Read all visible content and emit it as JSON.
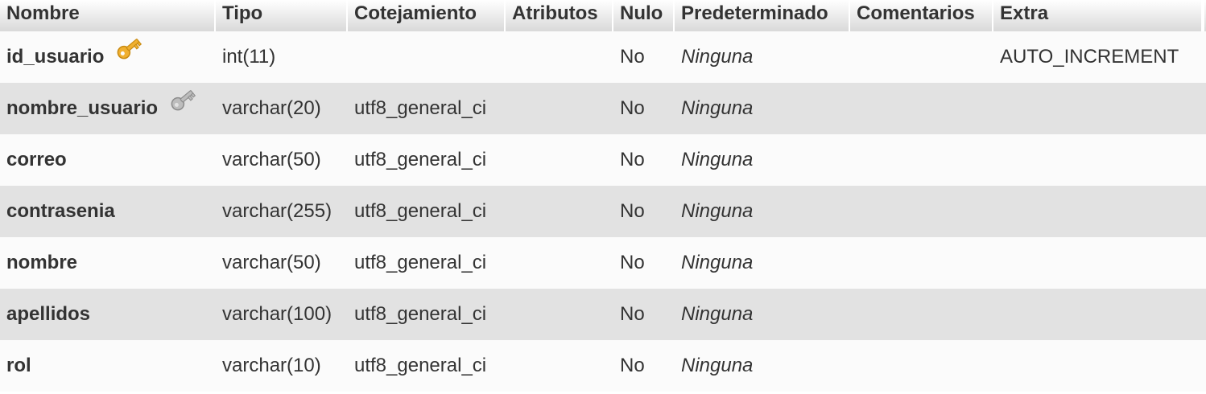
{
  "table": {
    "headers": {
      "nombre": "Nombre",
      "tipo": "Tipo",
      "cotejamiento": "Cotejamiento",
      "atributos": "Atributos",
      "nulo": "Nulo",
      "predeterminado": "Predeterminado",
      "comentarios": "Comentarios",
      "extra": "Extra"
    },
    "rows": [
      {
        "nombre": "id_usuario",
        "key_icon": "primary-key-icon",
        "tipo": "int(11)",
        "cotejamiento": "",
        "atributos": "",
        "nulo": "No",
        "predeterminado": "Ninguna",
        "comentarios": "",
        "extra": "AUTO_INCREMENT"
      },
      {
        "nombre": "nombre_usuario",
        "key_icon": "unique-key-icon",
        "tipo": "varchar(20)",
        "cotejamiento": "utf8_general_ci",
        "atributos": "",
        "nulo": "No",
        "predeterminado": "Ninguna",
        "comentarios": "",
        "extra": ""
      },
      {
        "nombre": "correo",
        "tipo": "varchar(50)",
        "cotejamiento": "utf8_general_ci",
        "atributos": "",
        "nulo": "No",
        "predeterminado": "Ninguna",
        "comentarios": "",
        "extra": ""
      },
      {
        "nombre": "contrasenia",
        "tipo": "varchar(255)",
        "cotejamiento": "utf8_general_ci",
        "atributos": "",
        "nulo": "No",
        "predeterminado": "Ninguna",
        "comentarios": "",
        "extra": ""
      },
      {
        "nombre": "nombre",
        "tipo": "varchar(50)",
        "cotejamiento": "utf8_general_ci",
        "atributos": "",
        "nulo": "No",
        "predeterminado": "Ninguna",
        "comentarios": "",
        "extra": ""
      },
      {
        "nombre": "apellidos",
        "tipo": "varchar(100)",
        "cotejamiento": "utf8_general_ci",
        "atributos": "",
        "nulo": "No",
        "predeterminado": "Ninguna",
        "comentarios": "",
        "extra": ""
      },
      {
        "nombre": "rol",
        "tipo": "varchar(10)",
        "cotejamiento": "utf8_general_ci",
        "atributos": "",
        "nulo": "No",
        "predeterminado": "Ninguna",
        "comentarios": "",
        "extra": ""
      }
    ]
  },
  "colors": {
    "primary_key": "#f0b030",
    "unique_key": "#a8a8a8",
    "row_even": "#e2e2e2",
    "row_odd": "#fbfbfb"
  }
}
